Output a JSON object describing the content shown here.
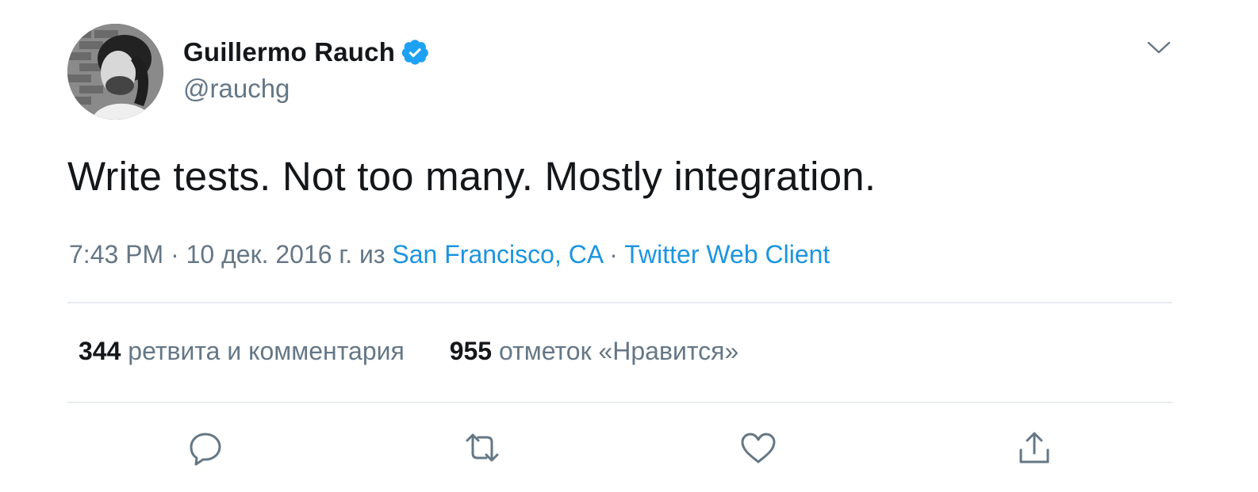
{
  "tweet": {
    "author": {
      "display_name": "Guillermo Rauch",
      "handle": "@rauchg",
      "verified": true
    },
    "text": "Write tests. Not too many. Mostly integration.",
    "meta": {
      "time": "7:43 PM",
      "separator": "·",
      "date": "10 дек. 2016 г.",
      "from_word": "из",
      "location": "San Francisco, CA",
      "client": "Twitter Web Client"
    },
    "stats": {
      "retweets_count": "344",
      "retweets_label": "ретвита и комментария",
      "likes_count": "955",
      "likes_label": "отметок «Нравится»"
    }
  },
  "icons": {
    "verified": "verified-badge-icon",
    "caret": "chevron-down-icon",
    "reply": "reply-icon",
    "retweet": "retweet-icon",
    "like": "heart-icon",
    "share": "share-icon"
  },
  "colors": {
    "text": "#14171a",
    "secondary": "#657786",
    "link": "#1b95e0",
    "divider": "#e6ecf0"
  }
}
